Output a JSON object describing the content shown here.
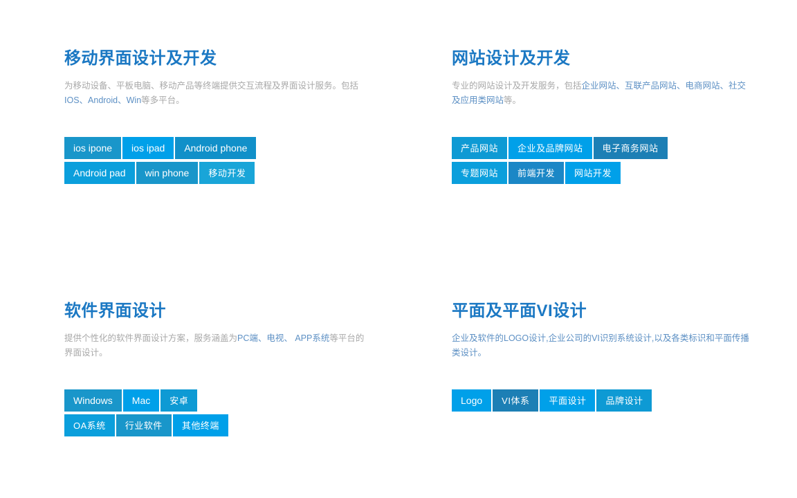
{
  "colors": {
    "heading": "#1b78c3",
    "body_text": "#a8a8a8",
    "link_text": "#5d90c4",
    "background": "#ffffff"
  },
  "sections": [
    {
      "id": "mobile-ui-design",
      "title": "移动界面设计及开发",
      "desc_plain": "为移动设备、平板电脑、移动产品等终端提供交互流程及界面设计服务。包括",
      "desc_link": "IOS、Android、Win",
      "desc_tail": "等多平台。",
      "tag_rows": [
        [
          {
            "label": "ios ipone",
            "shade": "sh-a",
            "cn": false
          },
          {
            "label": "ios ipad",
            "shade": "sh-b",
            "cn": false
          },
          {
            "label": "Android phone",
            "shade": "sh-e",
            "cn": false
          }
        ],
        [
          {
            "label": "Android pad",
            "shade": "sh-f",
            "cn": false
          },
          {
            "label": "win phone",
            "shade": "sh-a",
            "cn": false
          },
          {
            "label": "移动开发",
            "shade": "sh-h",
            "cn": true
          }
        ]
      ]
    },
    {
      "id": "website-design",
      "title": "网站设计及开发",
      "desc_plain": "专业的网站设计及开发服务，包括",
      "desc_link": "企业网站、互联产品网站、电商网站、社交及应用类网站",
      "desc_tail": "等。",
      "tag_rows": [
        [
          {
            "label": "产品网站",
            "shade": "sh-d",
            "cn": true
          },
          {
            "label": "企业及品牌网站",
            "shade": "sh-b",
            "cn": true
          },
          {
            "label": "电子商务网站",
            "shade": "sh-g",
            "cn": true
          }
        ],
        [
          {
            "label": "专题网站",
            "shade": "sh-f",
            "cn": true
          },
          {
            "label": "前端开发",
            "shade": "sh-c",
            "cn": true
          },
          {
            "label": "网站开发",
            "shade": "sh-b",
            "cn": true
          }
        ]
      ]
    },
    {
      "id": "software-ui-design",
      "title": "软件界面设计",
      "desc_plain": "提供个性化的软件界面设计方案，服务涵盖为",
      "desc_link": "PC端、电视、 APP系统",
      "desc_tail": "等平台的界面设计。",
      "tag_rows": [
        [
          {
            "label": "Windows",
            "shade": "sh-a",
            "cn": false
          },
          {
            "label": "Mac",
            "shade": "sh-b",
            "cn": false
          },
          {
            "label": "安卓",
            "shade": "sh-d",
            "cn": true
          }
        ],
        [
          {
            "label": "OA系统",
            "shade": "sh-f",
            "cn": true
          },
          {
            "label": "行业软件",
            "shade": "sh-a",
            "cn": true
          },
          {
            "label": "其他终端",
            "shade": "sh-b",
            "cn": true
          }
        ]
      ]
    },
    {
      "id": "graphic-vi-design",
      "title": "平面及平面VI设计",
      "desc_plain": "",
      "desc_link": "企业及软件的LOGO设计,企业公司的VI识别系统设计,以及各类标识和平面传播类设计。",
      "desc_tail": "",
      "tag_rows": [
        [
          {
            "label": "Logo",
            "shade": "sh-b",
            "cn": false
          },
          {
            "label": "VI体系",
            "shade": "sh-g",
            "cn": true
          },
          {
            "label": "平面设计",
            "shade": "sh-b",
            "cn": true
          },
          {
            "label": "品牌设计",
            "shade": "sh-d",
            "cn": true
          }
        ]
      ]
    }
  ]
}
